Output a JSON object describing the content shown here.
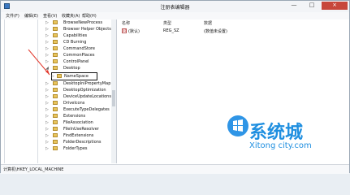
{
  "window": {
    "title": "注册表编辑器"
  },
  "menu": [
    "文件(F)",
    "编辑(E)",
    "查看(V)",
    "收藏夹(A)",
    "帮助(H)"
  ],
  "tree": {
    "items": [
      "BrowseNewProcess",
      "Browser Helper Objects",
      "Capabilities",
      "CD Burning",
      "CommandStore",
      "CommonPlaces",
      "ControlPanel",
      "Desktop",
      "NameSpace",
      "DesktopIniPropertyMap",
      "DesktopOptimization",
      "DeviceUpdateLocations",
      "DriveIcons",
      "ExecuteTypeDelegates",
      "Extensions",
      "FileAssociation",
      "FileInUseResolver",
      "FindExtensions",
      "FolderDescriptions",
      "FolderTypes"
    ],
    "selected": "NameSpace"
  },
  "list": {
    "columns": [
      "名称",
      "类型",
      "数据"
    ],
    "rows": [
      {
        "name": "(默认)",
        "type": "REG_SZ",
        "data": "(数值未设置)"
      }
    ]
  },
  "status": {
    "path": "计算机\\HKEY_LOCAL_MACHINE"
  },
  "watermark": {
    "cn": "系统城",
    "en": "Xitong city.com"
  }
}
